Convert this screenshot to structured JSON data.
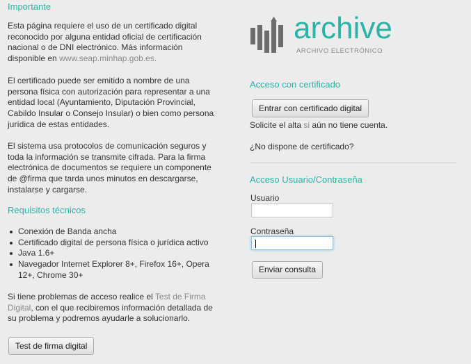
{
  "left": {
    "importante_heading": "Importante",
    "p1_text": "Esta página requiere el uso de un certificado digital reconocido por alguna entidad oficial de certificación nacional o de DNI electrónico. Más información disponible en",
    "p1_link": "www.seap.minhap.gob.es.",
    "p2": "El certificado puede ser emitido a nombre de una persona física con autorización para representar a una entidad local (Ayuntamiento, Diputación Provincial, Cabildo Insular o Consejo Insular) o bien como persona jurídica de estas entidades.",
    "p3": "El sistema usa protocolos de comunicación seguros y toda la información se transmite cifrada. Para la firma electrónica de documentos se requiere un componente de @firma que tarda unos minutos en descargarse, instalarse y cargarse.",
    "requisitos_heading": "Requisitos técnicos",
    "requirements": [
      "Conexión de Banda ancha",
      "Certificado digital de persona física o jurídica activo",
      "Java 1.6+",
      "Navegador Internet Explorer 8+, Firefox 16+, Opera 12+, Chrome 30+"
    ],
    "p4_before": "Si tiene problemas de acceso realice el",
    "p4_link": "Test de Firma Digital",
    "p4_after": ", con el que recibiremos información detallada de su problema y podremos ayudarle a solucionarlo.",
    "test_button": "Test de firma digital"
  },
  "logo": {
    "word": "archive",
    "subtitle": "ARCHIVO ELECTRÓNICO",
    "color": "#2bb3a8"
  },
  "right": {
    "cert_heading": "Acceso con certificado",
    "cert_button": "Entrar con certificado digital",
    "solicite_before": "Solicite el alta",
    "solicite_link": "si",
    "solicite_after": "aún no tiene cuenta.",
    "no_cert_link": "¿No dispone de certificado?",
    "user_heading": "Acceso Usuario/Contraseña",
    "usuario_label": "Usuario",
    "usuario_value": "",
    "password_label": "Contraseña",
    "password_value": "",
    "submit_button": "Enviar consulta"
  }
}
